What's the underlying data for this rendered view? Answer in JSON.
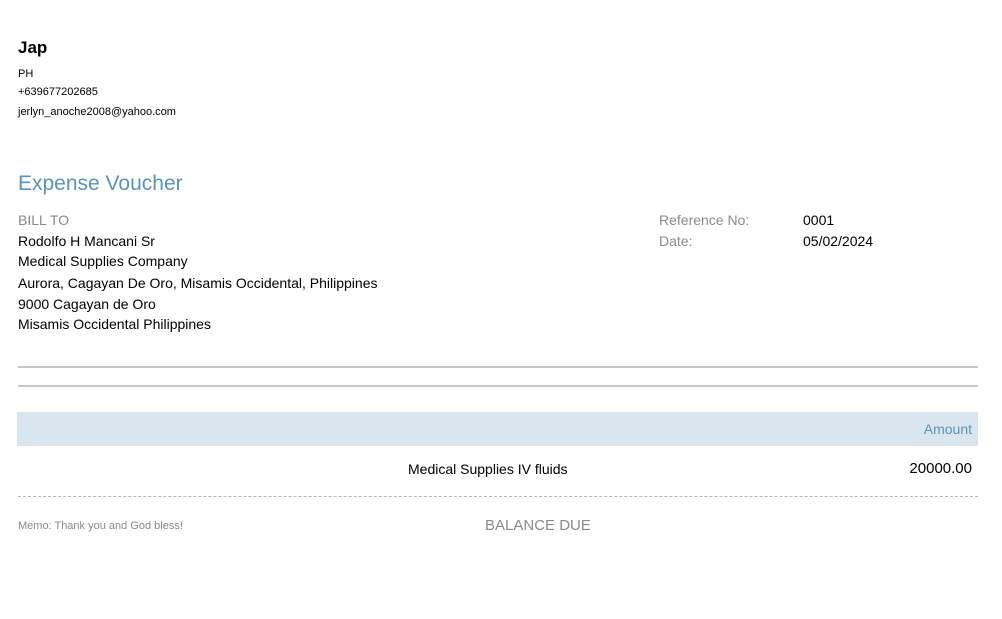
{
  "issuer": {
    "name": "Jap",
    "country": "PH",
    "phone": "+639677202685",
    "email": "jerlyn_anoche2008@yahoo.com"
  },
  "document": {
    "title": "Expense Voucher"
  },
  "bill_to": {
    "label": "BILL TO",
    "lines": [
      "Rodolfo H Mancani Sr",
      "Medical Supplies Company",
      "Aurora, Cagayan De Oro, Misamis Occidental, Philippines",
      "9000 Cagayan de Oro",
      "Misamis Occidental Philippines"
    ]
  },
  "meta": {
    "reference_label": "Reference No:",
    "reference_value": "0001",
    "date_label": "Date:",
    "date_value": "05/02/2024"
  },
  "table": {
    "amount_header": "Amount",
    "rows": [
      {
        "description": "Medical Supplies IV fluids",
        "amount": "20000.00"
      }
    ]
  },
  "footer": {
    "memo": "Memo: Thank you and God bless!",
    "balance_label": "BALANCE DUE"
  },
  "colors": {
    "accent": "#5b93b8",
    "header_fill": "#dae6ef",
    "muted_text": "#8a8a8a"
  }
}
